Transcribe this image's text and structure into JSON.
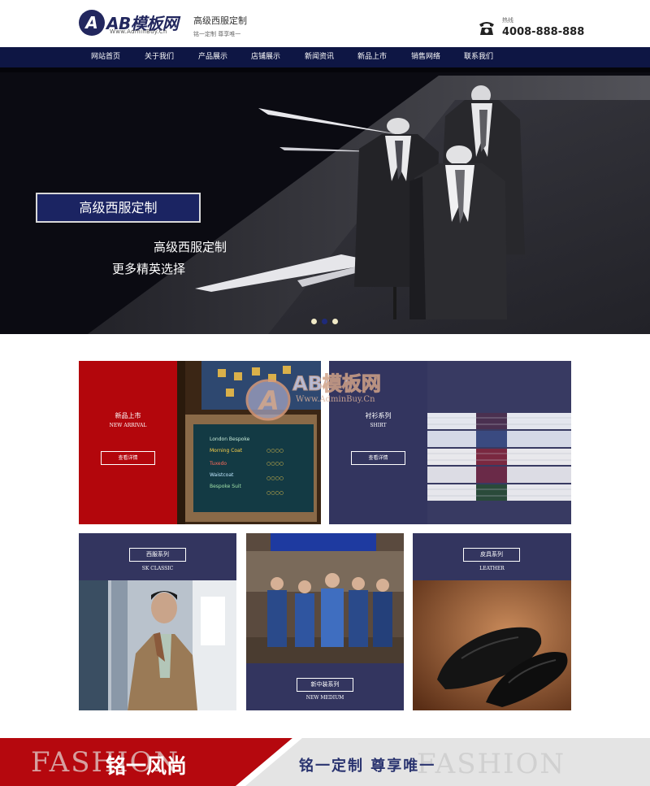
{
  "header": {
    "logo_mark": "A",
    "logo_text": "AB模板网",
    "logo_url": "Www.AdminBuy.Cn",
    "slogan_main": "高级西服定制",
    "slogan_sub": "铭一定制   尊享唯一",
    "hotline_label": "热线",
    "hotline_number": "4008-888-888",
    "phone_icon": "telephone-icon"
  },
  "nav": {
    "items": [
      {
        "label": "网站首页"
      },
      {
        "label": "关于我们"
      },
      {
        "label": "产品展示"
      },
      {
        "label": "店铺展示"
      },
      {
        "label": "新闻资讯"
      },
      {
        "label": "新品上市"
      },
      {
        "label": "销售网络"
      },
      {
        "label": "联系我们"
      }
    ],
    "background": "#0e1644"
  },
  "banner": {
    "box_text": "高级西服定制",
    "line1": "高级西服定制",
    "line2": "更多精英选择",
    "slides": 3,
    "active_slide": 2
  },
  "products": {
    "new_arrival": {
      "cn": "新品上市",
      "en": "NEW ARRIVAL",
      "button": "查看详情"
    },
    "shirt": {
      "cn": "衬衫系列",
      "en": "SHIRT",
      "button": "查看详情"
    },
    "suit": {
      "cn": "西服系列",
      "en": "SK CLASSIC"
    },
    "medium": {
      "cn": "新中装系列",
      "en": "NEW MEDIUM"
    },
    "leather": {
      "cn": "皮具系列",
      "en": "LEATHER"
    }
  },
  "watermark": {
    "text": "AB模板网",
    "url": "Www.AdminBuy.Cn"
  },
  "bottom_banner": {
    "bg_left": "FASHION",
    "title": "铭一风尚",
    "subtitle": "铭一定制  尊享唯一",
    "bg_right": "FASHION"
  },
  "colors": {
    "navy": "#0e1644",
    "panel_navy": "#33355f",
    "red": "#b3060c",
    "banner_box": "#1b2462"
  }
}
